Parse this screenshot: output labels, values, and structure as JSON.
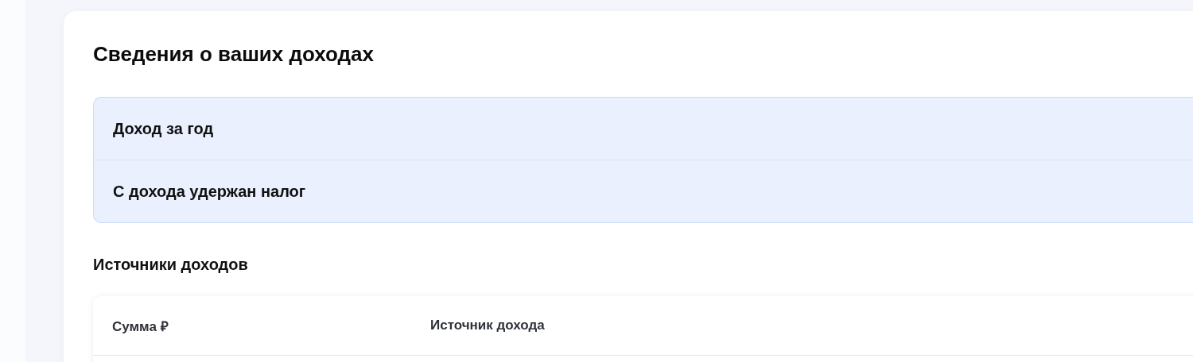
{
  "title": "Сведения о ваших доходах",
  "summary_rows": [
    {
      "label": "Доход за год"
    },
    {
      "label": "С дохода удержан налог"
    }
  ],
  "sources": {
    "heading": "Источники доходов",
    "columns": [
      "Сумма ₽",
      "Источник дохода"
    ]
  }
}
